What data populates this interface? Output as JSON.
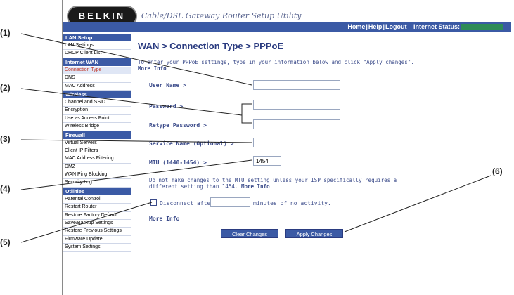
{
  "header": {
    "logo": "BELKIN",
    "tagline": "Cable/DSL Gateway Router Setup Utility",
    "links": [
      "Home",
      "Help",
      "Logout"
    ],
    "internet_status_label": "Internet Status:"
  },
  "sidebar": {
    "sections": [
      {
        "title": "LAN Setup",
        "items": [
          "LAN Settings",
          "DHCP Client List"
        ]
      },
      {
        "title": "Internet WAN",
        "items": [
          "Connection Type",
          "DNS",
          "MAC Address"
        ]
      },
      {
        "title": "Wireless",
        "items": [
          "Channel and SSID",
          "Encryption",
          "Use as Access Point",
          "Wireless Bridge"
        ]
      },
      {
        "title": "Firewall",
        "items": [
          "Virtual Servers",
          "Client IP Filters",
          "MAC Address Filtering",
          "DMZ",
          "WAN Ping Blocking",
          "Security Log"
        ]
      },
      {
        "title": "Utilities",
        "items": [
          "Parental Control",
          "Restart Router",
          "Restore Factory Default",
          "Save/Backup Settings",
          "Restore Previous Settings",
          "Firmware Update",
          "System Settings"
        ]
      }
    ]
  },
  "main": {
    "title": "WAN > Connection Type > PPPoE",
    "intro": "To enter your PPPoE settings, type in your information below and click \"Apply changes\".",
    "intro_more": "More Info",
    "fields": {
      "username_label": "User Name >",
      "password_label": "Password >",
      "retype_label": "Retype Password >",
      "service_label": "Service Name (Optional) >",
      "mtu_label": "MTU (1440-1454) >",
      "mtu_value": "1454"
    },
    "note": "Do not make changes to the MTU setting unless your ISP specifically requires a different setting than 1454.",
    "note_more": "More Info",
    "disconnect_pre": "Disconnect after",
    "disconnect_post": "minutes of no activity.",
    "more_info": "More Info",
    "buttons": {
      "clear": "Clear Changes",
      "apply": "Apply Changes"
    }
  },
  "callouts": [
    "(1)",
    "(2)",
    "(3)",
    "(4)",
    "(5)",
    "(6)"
  ]
}
